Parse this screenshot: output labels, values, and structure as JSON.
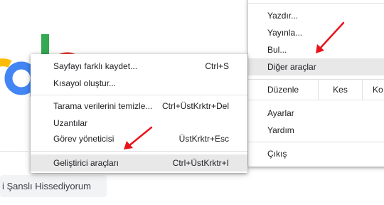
{
  "google_logo": {
    "letters": [
      "g",
      "l",
      "e"
    ],
    "colors": {
      "blue": "#4285f4",
      "red": "#ea4335",
      "yellow": "#fbbc05",
      "green": "#34a853"
    }
  },
  "lucky_button": {
    "label": "i Şanslı Hissediyorum"
  },
  "main_menu": {
    "print": "Yazdır...",
    "cast": "Yayınla...",
    "find": "Bul...",
    "more_tools": "Diğer araçlar",
    "edit_label": "Düzenle",
    "cut": "Kes",
    "copy_partial": "Ko",
    "settings": "Ayarlar",
    "help": "Yardım",
    "exit": "Çıkış"
  },
  "submenu": {
    "items": [
      {
        "label": "Sayfayı farklı kaydet...",
        "shortcut": "Ctrl+S"
      },
      {
        "label": "Kısayol oluştur...",
        "shortcut": ""
      },
      {
        "label": "Tarama verilerini temizle...",
        "shortcut": "Ctrl+ÜstKrktr+Del"
      },
      {
        "label": "Uzantılar",
        "shortcut": ""
      },
      {
        "label": "Görev yöneticisi",
        "shortcut": "ÜstKrktr+Esc"
      },
      {
        "label": "Geliştirici araçları",
        "shortcut": "Ctrl+ÜstKrktr+I"
      }
    ]
  },
  "annotation_color": "#e8141b"
}
